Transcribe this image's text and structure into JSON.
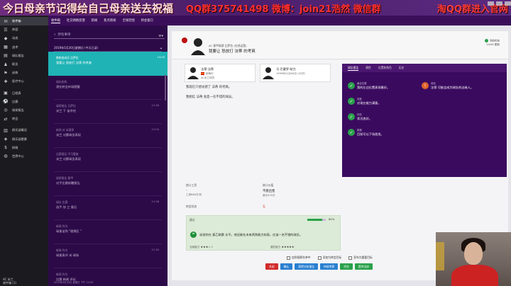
{
  "overlay": {
    "left_text": "今日母亲节记得给自己母亲送去祝福",
    "mid_text": "QQ群375741498 微博：join21浩然 微信群",
    "right_text": "淘QQ群进入官网"
  },
  "sidebar": {
    "items": [
      {
        "label": "收件箱",
        "icon": "inbox-icon",
        "glyph": "✉"
      },
      {
        "label": "阵容",
        "icon": "squad-icon",
        "glyph": "☰"
      },
      {
        "label": "动态",
        "icon": "dynamics-icon",
        "glyph": "◆"
      },
      {
        "label": "战术",
        "icon": "tactics-icon",
        "glyph": "▦"
      },
      {
        "label": "球队报告",
        "icon": "report-icon",
        "glyph": "▤"
      },
      {
        "label": "职员",
        "icon": "staff-icon",
        "glyph": "♟"
      },
      {
        "label": "训练",
        "icon": "training-icon",
        "glyph": "⚑"
      },
      {
        "label": "医疗中心",
        "icon": "medical-icon",
        "glyph": "✚"
      },
      {
        "label": "日程表",
        "icon": "schedule-icon",
        "glyph": "▣"
      },
      {
        "label": "比赛",
        "icon": "match-icon",
        "glyph": "⚽"
      },
      {
        "label": "球探报告",
        "icon": "scouting-icon",
        "glyph": "◎"
      },
      {
        "label": "转会",
        "icon": "transfer-icon",
        "glyph": "⇄"
      },
      {
        "label": "俱乐部概况",
        "icon": "club-info-icon",
        "glyph": "▥"
      },
      {
        "label": "俱乐部愿景",
        "icon": "vision-icon",
        "glyph": "◈"
      },
      {
        "label": "财政",
        "icon": "finance-icon",
        "glyph": "$"
      },
      {
        "label": "世界中心",
        "icon": "world-icon",
        "glyph": "◍"
      }
    ],
    "footer_line1": "AC 米兰",
    "footer_line2": "收件箱 (1)"
  },
  "topbar": {
    "tabs": [
      "收件箱",
      "社交网络反馈",
      "新闻",
      "焦点新闻",
      "全球范围",
      "转会窗口"
    ]
  },
  "leftpanel": {
    "search_placeholder": "所有事项",
    "group_header": "2019年5月30日星期日 (今天已读)",
    "messages": [
      {
        "sender": "教练组成员 比萨拉",
        "subject": "我要让 怒放打 法蒂 的考爽",
        "time": "14:00"
      },
      {
        "sender": "球队机构",
        "subject": "潜在转会市场提醒",
        "time": ""
      },
      {
        "sender": "球探报告 日萨拉",
        "subject": "米兰 下 该评估",
        "time": "12:48"
      },
      {
        "sender": "新闻 对 本赛季",
        "subject": "米兰 对赛球员表现",
        "time": "12:00"
      },
      {
        "sender": "比赛报告 不可重复",
        "subject": "米兰 对赛球员表现",
        "time": ""
      },
      {
        "sender": "球探报告 意甲",
        "subject": "对手比赛前瞻报告",
        "time": ""
      },
      {
        "sender": "球队 比赛",
        "subject": "选手 协 三 意见",
        "time": "11:38"
      },
      {
        "sender": "新闻 作为",
        "subject": "球星谈到 \"理想区 \"",
        "time": ""
      },
      {
        "sender": "新闻 作为",
        "subject": "球星表评 米 球场",
        "time": "11:30"
      },
      {
        "sender": "新闻 作为",
        "subject": "比赛 新闻 评论",
        "time": ""
      }
    ],
    "footer": "2019年5月30日 星期日 下午 14:00"
  },
  "message": {
    "header_sub": "AC 意甲联赛 比萨拉 (在线运营)",
    "header_title": "我要让 怒放打 法蒂 的考爽",
    "header_right_line1": "当前状态",
    "header_right_line2": "14:00 更新",
    "player_name": "法蒂·法蒂",
    "player_position": "前锋中",
    "player_club": "AC米兰球员",
    "coach_name": "马·巴塞罗·助力",
    "coach_detail": "1999年01月06日 (20岁)",
    "body": [
      "我现在只想光感了 法蒂 的考爽。",
      "我相信 法蒂 会是一名不错的球员。"
    ],
    "stat1_label": "统计工资",
    "stat1_value": "-",
    "stat1_sub": "工资880万/年",
    "stat2_label": "统计价值",
    "stat2_value": "不愿出售",
    "stat2_sub": "身价470万",
    "stat3_label": "转会状态",
    "stat3_value": "无",
    "green_title": "建议",
    "green_pct": "80%",
    "green_text": "说说你在 意乙联赛 水平。他还能在未来两到能力较高，应该一名不错的球员。",
    "rating_left": "当前能力",
    "rating_right": "潜在能力",
    "stars_left": "★★★☆☆",
    "stars_right": "★★★★★"
  },
  "purple_panel": {
    "tabs": [
      "球队报告",
      "属性",
      "位置和角色",
      "历史"
    ],
    "items": [
      {
        "title": "最佳位置",
        "text": "我的左边位置表现最好。",
        "color": "#2aa14a",
        "glyph": "✓"
      },
      {
        "title": "态度",
        "text": "对现在能力满意。",
        "color": "#2aa14a",
        "glyph": "✓"
      },
      {
        "title": "状态",
        "text": "状况良好。",
        "color": "#2aa14a",
        "glyph": "✓"
      },
      {
        "title": "数据",
        "text": "目前可以下场首发。",
        "color": "#2aa14a",
        "glyph": "✓"
      },
      {
        "title": "风险",
        "text": "法蒂 可能会成为球队的边缘人。",
        "color": "#e0632d",
        "glyph": "!"
      }
    ]
  },
  "checks": [
    "加到观察名单中",
    "添加为转会目标",
    "宣布为重要目标"
  ],
  "buttons": [
    {
      "label": "关闭",
      "color": "#d12b2b"
    },
    {
      "label": "确认",
      "color": "#2a7fd1"
    },
    {
      "label": "获得分析报告",
      "color": "#2a7fd1"
    },
    {
      "label": "持续考察",
      "color": "#2a7fd1"
    },
    {
      "label": "评估",
      "color": "#2aa14a"
    },
    {
      "label": "提供试训",
      "color": "#2aa14a"
    }
  ],
  "colors": {
    "sidebar_bg": "#1b1b1f",
    "panel_purple": "#3a0a5f",
    "selected_teal": "#1fb3b5",
    "accent_green": "#2aa14a",
    "accent_red": "#d12b2b"
  }
}
